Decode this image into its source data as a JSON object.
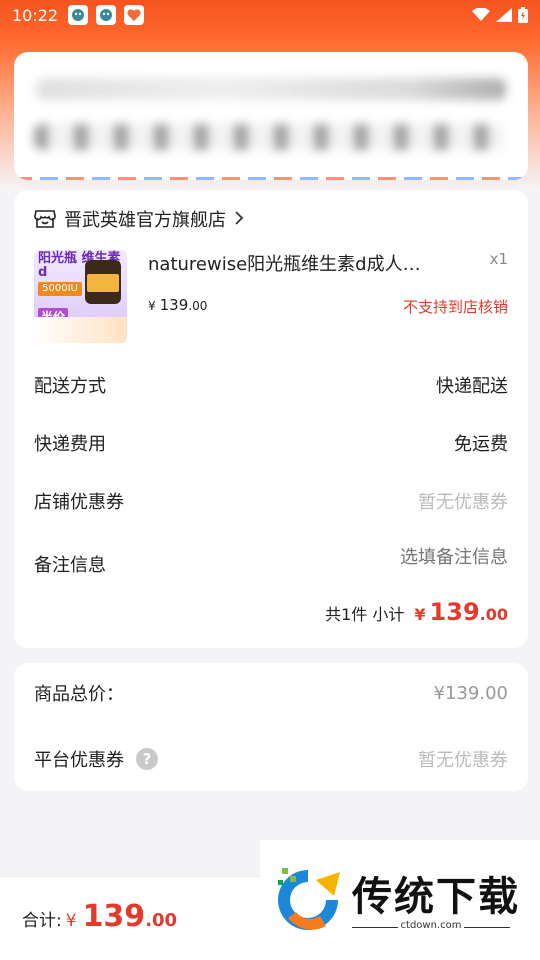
{
  "status_bar": {
    "time": "10:22"
  },
  "shop": {
    "icon": "shop-icon",
    "name": "晋武英雄官方旗舰店"
  },
  "product": {
    "title": "naturewise阳光瓶维生素d成人…",
    "quantity": "x1",
    "price_currency": "¥",
    "price_integer": "139",
    "price_decimal": ".00",
    "note": "不支持到店核销",
    "image": {
      "title": "阳光瓶 维生素d",
      "badge": "5000IU",
      "tag": "半价"
    }
  },
  "order_rows": [
    {
      "label": "配送方式",
      "value": "快递配送"
    },
    {
      "label": "快递费用",
      "value": "免运费"
    },
    {
      "label": "店铺优惠券",
      "value": "暂无优惠券"
    },
    {
      "label": "备注信息",
      "value": "选填备注信息"
    }
  ],
  "subtotal": {
    "text": "共1件 小计",
    "currency": "¥",
    "integer": "139",
    "decimal": ".00"
  },
  "summary": {
    "goods_total_label": "商品总价：",
    "goods_total_value": "¥139.00",
    "platform_coupon_label": "平台优惠券",
    "platform_coupon_value": "暂无优惠券"
  },
  "bottom": {
    "total_label": "合计:",
    "currency": "¥",
    "integer": "139",
    "decimal": ".00"
  },
  "watermark": {
    "text": "传统下载",
    "url": "ctdown.com"
  },
  "colors": {
    "accent": "#e53a2b",
    "header": "#f5531f"
  }
}
